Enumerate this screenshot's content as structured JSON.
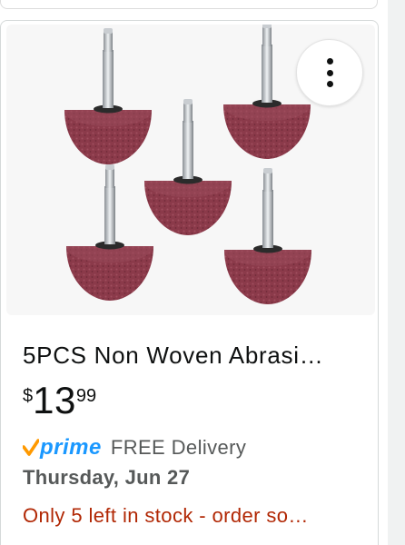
{
  "product": {
    "title": "5PCS Non Woven Abrasi…",
    "price": {
      "symbol": "$",
      "whole": "13",
      "fraction": "99"
    },
    "prime_label": "prime",
    "delivery_label": "FREE Delivery",
    "delivery_date": "Thursday, Jun 27",
    "stock_message": "Only 5 left in stock - order so…"
  },
  "image": {
    "subject": "mounted-abrasive-wheels",
    "count": 5,
    "wheel_color": "#8b3a4a",
    "background": "#f7f7f7"
  },
  "colors": {
    "prime_blue": "#1a98ff",
    "prime_check": "#ff9900",
    "stock_red": "#b12704",
    "text": "#0f1111",
    "secondary": "#565959"
  },
  "icons": {
    "more": "more-vert-icon",
    "prime_check": "prime-check-icon"
  }
}
